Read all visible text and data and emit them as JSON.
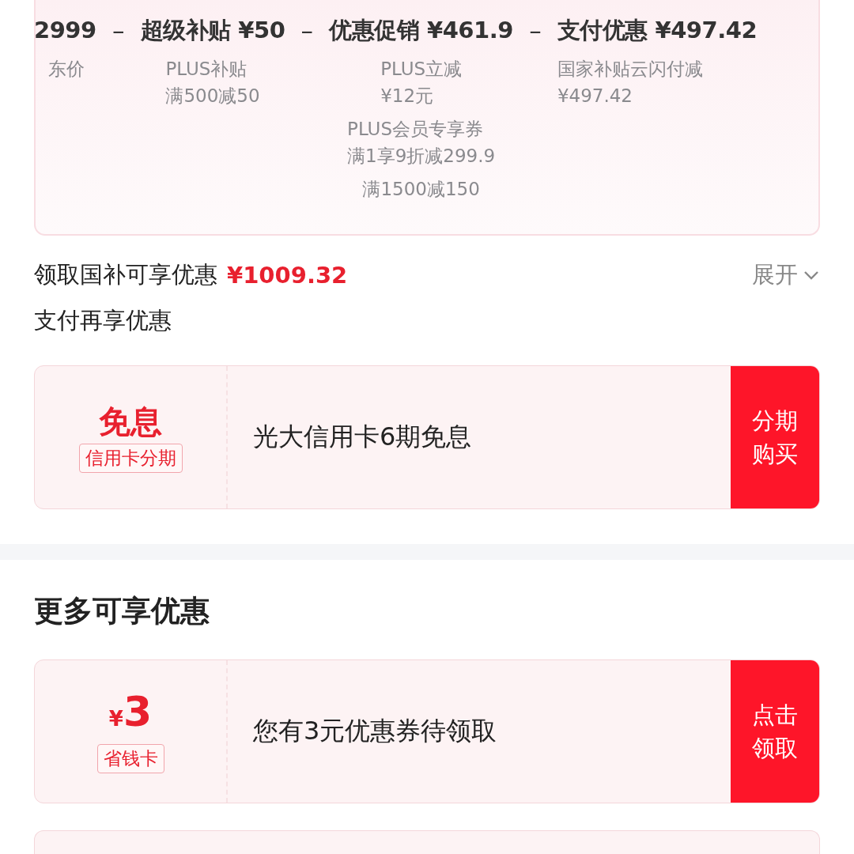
{
  "price_breakdown": [
    {
      "amount": "2999",
      "details": [
        [
          "东价"
        ]
      ]
    },
    {
      "operator": "–",
      "label": "超级补贴",
      "amount": "¥50",
      "details": [
        [
          "PLUS补贴",
          "满500减50"
        ]
      ]
    },
    {
      "operator": "–",
      "label": "优惠促销",
      "amount": "¥461.9",
      "details": [
        [
          "PLUS立减",
          "¥12元"
        ],
        [
          "PLUS会员专享券",
          "满1享9折减299.9"
        ],
        [
          "满1500减150"
        ]
      ]
    },
    {
      "operator": "–",
      "label": "支付优惠",
      "amount": "¥497.42",
      "details": [
        [
          "国家补贴云闪付减",
          "¥497.42"
        ]
      ]
    }
  ],
  "subsidy": {
    "label": "领取国补可享优惠",
    "amount": "¥1009.32",
    "toggle": "展开"
  },
  "pay_section": {
    "title": "支付再享优惠",
    "offers": [
      {
        "kind": "text",
        "headline": "免息",
        "tag": "信用卡分期",
        "description": "光大信用卡6期免息",
        "action": "分期购买"
      }
    ]
  },
  "more_section": {
    "title": "更多可享优惠",
    "offers": [
      {
        "kind": "money",
        "currency": "¥",
        "headline": "3",
        "tag": "省钱卡",
        "description": "您有3元优惠券待领取",
        "action": "点击领取"
      }
    ]
  }
}
